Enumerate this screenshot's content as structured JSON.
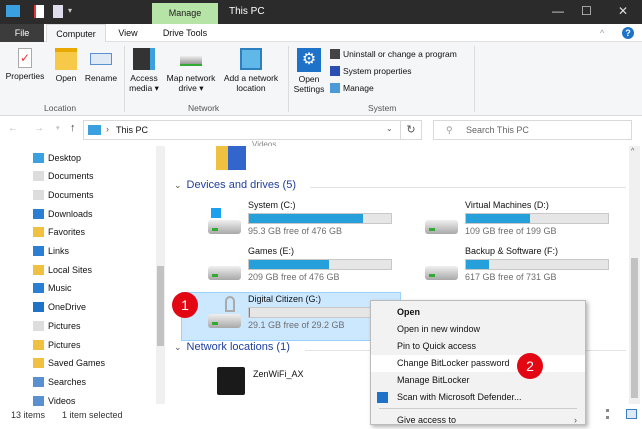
{
  "titlebar": {
    "title": "This PC",
    "manage_tab": "Manage",
    "minimize": "—",
    "maximize": "☐",
    "close": "✕"
  },
  "tabs": {
    "file": "File",
    "computer": "Computer",
    "view": "View",
    "drive_tools": "Drive Tools",
    "help": "?"
  },
  "ribbon": {
    "location": {
      "label": "Location",
      "properties": "Properties",
      "open": "Open",
      "rename": "Rename"
    },
    "network": {
      "label": "Network",
      "access_media": "Access media ▾",
      "map_drive": "Map network drive ▾",
      "add_location": "Add a network location"
    },
    "system": {
      "label": "System",
      "open_settings": "Open Settings",
      "uninstall": "Uninstall or change a program",
      "system_properties": "System properties",
      "manage": "Manage"
    }
  },
  "address": {
    "path": "This PC",
    "search_placeholder": "Search This PC"
  },
  "nav": [
    "Desktop",
    "Documents",
    "Documents",
    "Downloads",
    "Favorites",
    "Links",
    "Local Sites",
    "Music",
    "OneDrive",
    "Pictures",
    "Pictures",
    "Saved Games",
    "Searches",
    "Videos"
  ],
  "content": {
    "folder_partial": "Videos",
    "devices_header": "Devices and drives (5)",
    "drives": [
      {
        "name": "System (C:)",
        "free": "95.3 GB free of 476 GB",
        "used_fraction": 0.8
      },
      {
        "name": "Virtual Machines (D:)",
        "free": "109 GB free of 199 GB",
        "used_fraction": 0.45
      },
      {
        "name": "Games (E:)",
        "free": "209 GB free of 476 GB",
        "used_fraction": 0.56
      },
      {
        "name": "Backup & Software (F:)",
        "free": "617 GB free of 731 GB",
        "used_fraction": 0.16
      },
      {
        "name": "Digital Citizen (G:)",
        "free": "29.1 GB free of 29.2 GB",
        "used_fraction": 0.003
      }
    ],
    "network_header": "Network locations (1)",
    "network_item": "ZenWiFi_AX"
  },
  "context_menu": [
    "Open",
    "Open in new window",
    "Pin to Quick access",
    "Change BitLocker password",
    "Manage BitLocker",
    "Scan with Microsoft Defender...",
    "Give access to"
  ],
  "badges": {
    "one": "1",
    "two": "2"
  },
  "status": {
    "items": "13 items",
    "selected": "1 item selected"
  },
  "colors": {
    "accent": "#26a0da",
    "badge": "#e30613",
    "header": "#1e3f9e"
  }
}
